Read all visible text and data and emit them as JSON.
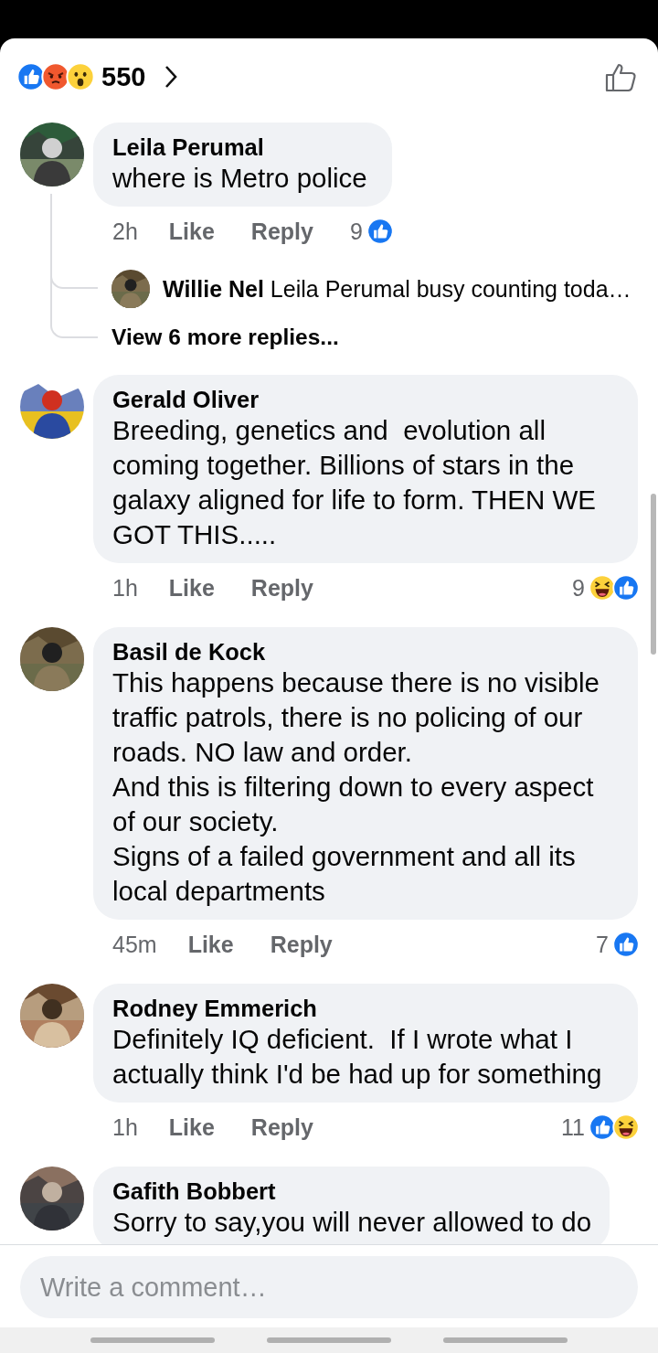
{
  "header": {
    "reactions": [
      {
        "kind": "like"
      },
      {
        "kind": "angry"
      },
      {
        "kind": "wow"
      }
    ],
    "count": "550"
  },
  "comments": [
    {
      "author": "Leila Perumal",
      "text": "where is Metro police",
      "time": "2h",
      "actions": [
        "Like",
        "Reply"
      ],
      "reaction_count": "9",
      "reactions": [
        {
          "kind": "like"
        }
      ],
      "replies": [
        {
          "author": "Willie Nel",
          "text": "Leila Perumal busy counting toda…"
        }
      ],
      "more_replies": "View 6 more replies..."
    },
    {
      "author": "Gerald Oliver",
      "text": "Breeding, genetics and  evolution all coming together. Billions of stars in the galaxy aligned for life to form. THEN WE GOT THIS.....",
      "time": "1h",
      "actions": [
        "Like",
        "Reply"
      ],
      "reaction_count": "9",
      "reactions": [
        {
          "kind": "haha"
        },
        {
          "kind": "like"
        }
      ]
    },
    {
      "author": "Basil de Kock",
      "text": "This happens because there is no visible traffic patrols, there is no policing of our roads. NO law and order.\nAnd this is filtering down to every aspect of our society.\nSigns of a failed government and all its local departments",
      "time": "45m",
      "actions": [
        "Like",
        "Reply"
      ],
      "reaction_count": "7",
      "reactions": [
        {
          "kind": "like"
        }
      ]
    },
    {
      "author": "Rodney Emmerich",
      "text": "Definitely IQ deficient.  If I wrote what I actually think I'd be had up for something",
      "time": "1h",
      "actions": [
        "Like",
        "Reply"
      ],
      "reaction_count": "11",
      "reactions": [
        {
          "kind": "like"
        },
        {
          "kind": "haha"
        }
      ]
    },
    {
      "author": "Gafith Bobbert",
      "text": "Sorry to say,you will never allowed to do"
    }
  ],
  "composer": {
    "placeholder": "Write a comment…"
  }
}
